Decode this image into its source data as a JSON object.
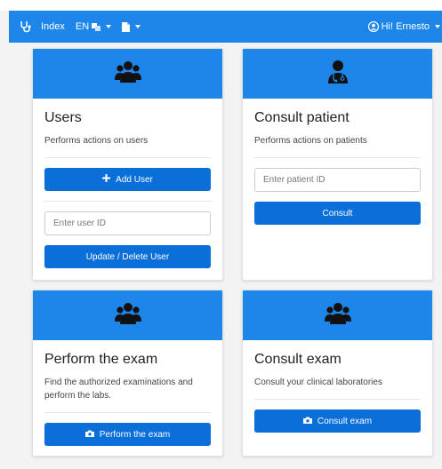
{
  "nav": {
    "index_label": "Index",
    "language_label": "EN",
    "greeting": "Hi! Ernesto"
  },
  "cards": {
    "users": {
      "title": "Users",
      "description": "Performs actions on users",
      "add_button": "Add User",
      "input_placeholder": "Enter user ID",
      "update_button": "Update / Delete User"
    },
    "patient": {
      "title": "Consult patient",
      "description": "Performs actions on patients",
      "input_placeholder": "Enter patient ID",
      "consult_button": "Consult"
    },
    "perform": {
      "title": "Perform the exam",
      "description": "Find the authorized examinations and perform the labs.",
      "button": "Perform the exam"
    },
    "exam": {
      "title": "Consult exam",
      "description": "Consult your clinical laboratories",
      "button": "Consult exam"
    }
  },
  "colors": {
    "navbar": "#1d86e8",
    "card_header": "#1d86e8",
    "button": "#0a6fd8",
    "page_background": "#f3f3f3"
  },
  "icons": {
    "brand": "stethoscope-icon",
    "language": "translate-icon",
    "document": "document-icon",
    "user": "user-circle-icon",
    "users_card": "users-group-icon",
    "patient_card": "doctor-icon",
    "add": "plus-icon",
    "camera": "camera-icon"
  }
}
